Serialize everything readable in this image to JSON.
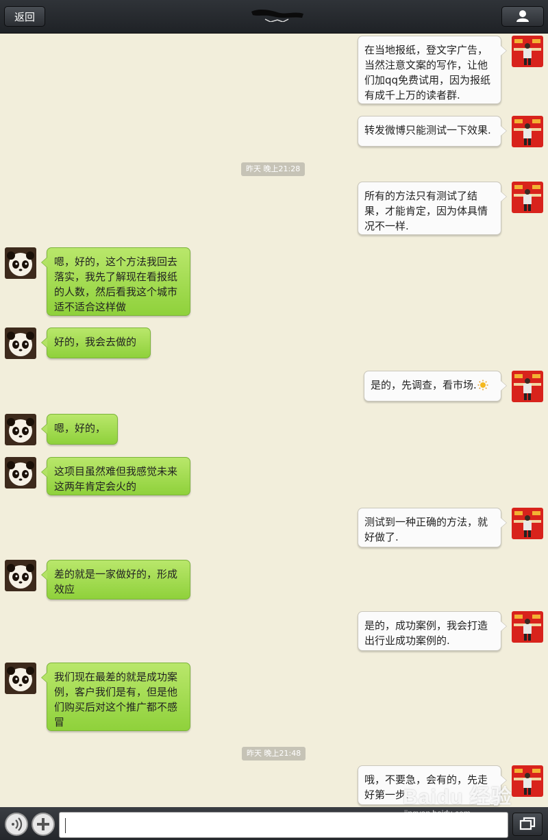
{
  "header": {
    "back_label": "返回"
  },
  "messages": [
    {
      "type": "out",
      "text": "在当地报纸，登文字广告，当然注意文案的写作，让他们加qq免费试用，因为报纸有成千上万的读者群."
    },
    {
      "type": "out",
      "text": "转发微博只能测试一下效果."
    },
    {
      "type": "time",
      "text": "昨天 晚上21:28"
    },
    {
      "type": "out",
      "text": "所有的方法只有测试了结果，才能肯定，因为体具情况不一样."
    },
    {
      "type": "in",
      "text": "嗯，好的，这个方法我回去落实，我先了解现在看报纸的人数，然后看我这个城市适不适合这样做"
    },
    {
      "type": "in",
      "text": "好的，我会去做的"
    },
    {
      "type": "out",
      "text": "是的，先调查，看市场.",
      "emoji": "sun-emoji"
    },
    {
      "type": "in",
      "text": "嗯，好的，"
    },
    {
      "type": "in",
      "text": "这项目虽然难但我感觉未来这两年肯定会火的"
    },
    {
      "type": "out",
      "text": "测试到一种正确的方法，就好做了."
    },
    {
      "type": "in",
      "text": "差的就是一家做好的，形成效应"
    },
    {
      "type": "out",
      "text": "是的，成功案例，我会打造出行业成功案例的."
    },
    {
      "type": "in",
      "text": "我们现在最差的就是成功案例，客户我们是有，但是他们购买后对这个推广都不感冒"
    },
    {
      "type": "time",
      "text": "昨天 晚上21:48"
    },
    {
      "type": "out",
      "text": "哦，不要急，会有的，先走好第一步."
    }
  ],
  "watermark": {
    "main": "Baidu 经验",
    "sub": "jingyan.baidu.com"
  }
}
